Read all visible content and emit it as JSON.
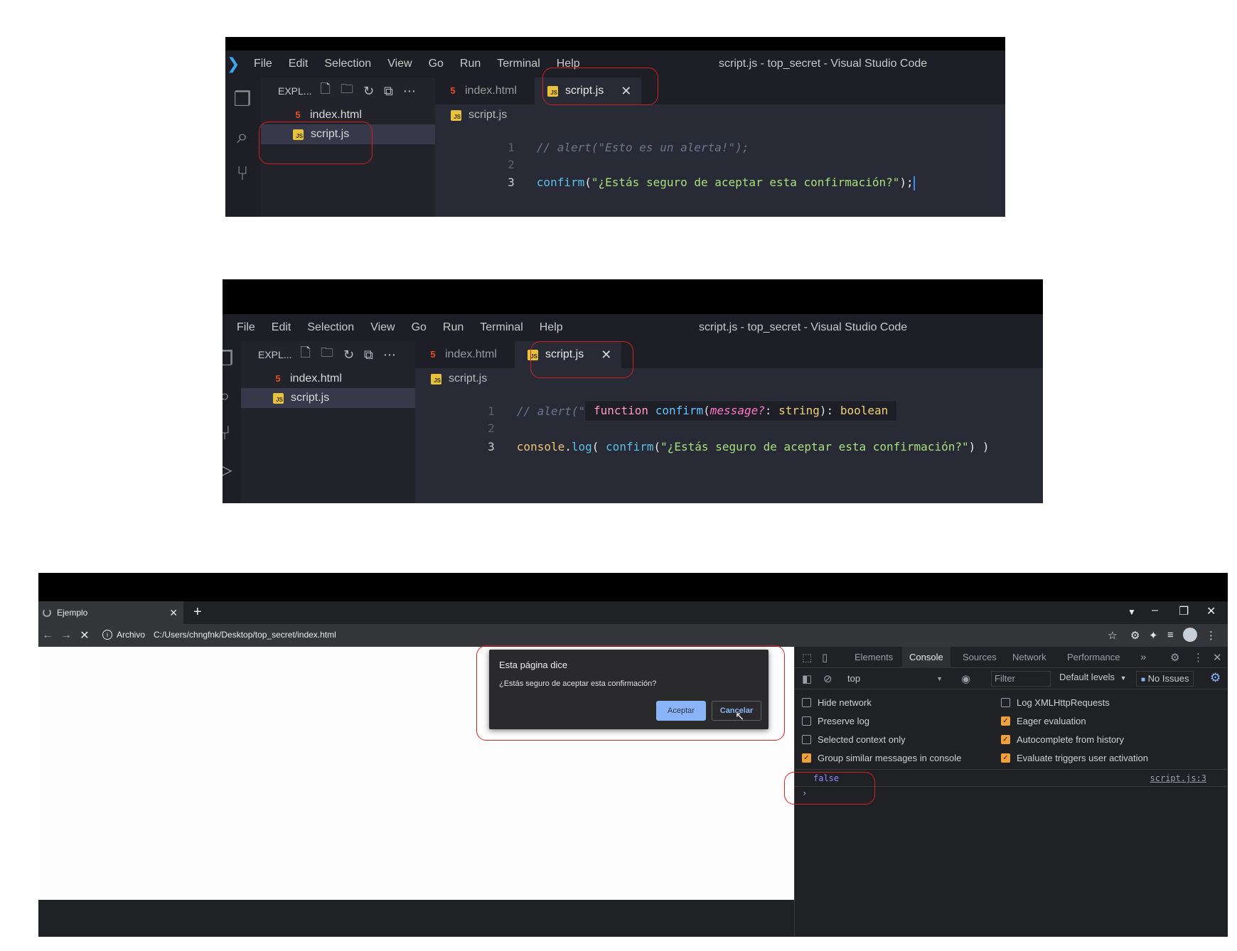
{
  "vscode": {
    "menu": [
      "File",
      "Edit",
      "Selection",
      "View",
      "Go",
      "Run",
      "Terminal",
      "Help"
    ],
    "window_title": "script.js - top_secret - Visual Studio Code",
    "explorer_label": "EXPL...",
    "files": [
      "index.html",
      "script.js"
    ],
    "tabs": [
      "index.html",
      "script.js"
    ],
    "breadcrumb": "script.js",
    "line_numbers": [
      "1",
      "2",
      "3"
    ],
    "shot1": {
      "line1": "// alert(\"Esto es un alerta!\");",
      "line3_fn": "confirm",
      "line3_paren": "(",
      "line3_str": "\"¿Estás seguro de aceptar esta confirmación?\"",
      "line3_end": ");"
    },
    "shot2": {
      "line1": "// alert(\"Esto es un alerta!\");",
      "line3_obj": "console",
      "line3_dot": ".",
      "line3_method": "log",
      "line3_open": "( ",
      "line3_fn": "confirm",
      "line3_paren": "(",
      "line3_str": "\"¿Estás seguro de aceptar esta confirmación?\"",
      "line3_end": ") )",
      "tooltip": {
        "kw": "function",
        "fn": "confirm",
        "open": "(",
        "param": "message?",
        "mid": ": ",
        "type1": "string",
        "close": "): ",
        "type2": "boolean"
      }
    }
  },
  "chrome": {
    "tab_title": "Ejemplo",
    "address_scheme": "Archivo",
    "address_url": "C:/Users/chngfnk/Desktop/top_secret/index.html",
    "dialog": {
      "title": "Esta página dice",
      "message": "¿Estás seguro de aceptar esta confirmación?",
      "ok": "Aceptar",
      "cancel": "Cancelar"
    }
  },
  "devtools": {
    "tabs": [
      "Elements",
      "Console",
      "Sources",
      "Network",
      "Performance"
    ],
    "context": "top",
    "filter_placeholder": "Filter",
    "levels": "Default levels",
    "issues": "No Issues",
    "options_left": [
      {
        "label": "Hide network",
        "checked": false
      },
      {
        "label": "Preserve log",
        "checked": false
      },
      {
        "label": "Selected context only",
        "checked": false
      },
      {
        "label": "Group similar messages in console",
        "checked": true
      }
    ],
    "options_right": [
      {
        "label": "Log XMLHttpRequests",
        "checked": false
      },
      {
        "label": "Eager evaluation",
        "checked": true
      },
      {
        "label": "Autocomplete from history",
        "checked": true
      },
      {
        "label": "Evaluate triggers user activation",
        "checked": true
      }
    ],
    "log_value": "false",
    "log_source": "script.js:3"
  },
  "colors": {
    "js_badge": "#e8c23a",
    "html_icon": "#e34c26",
    "annotation_red": "#d32020",
    "chrome_accent": "#8ab4f8",
    "checkbox_orange": "#f2a03a"
  }
}
